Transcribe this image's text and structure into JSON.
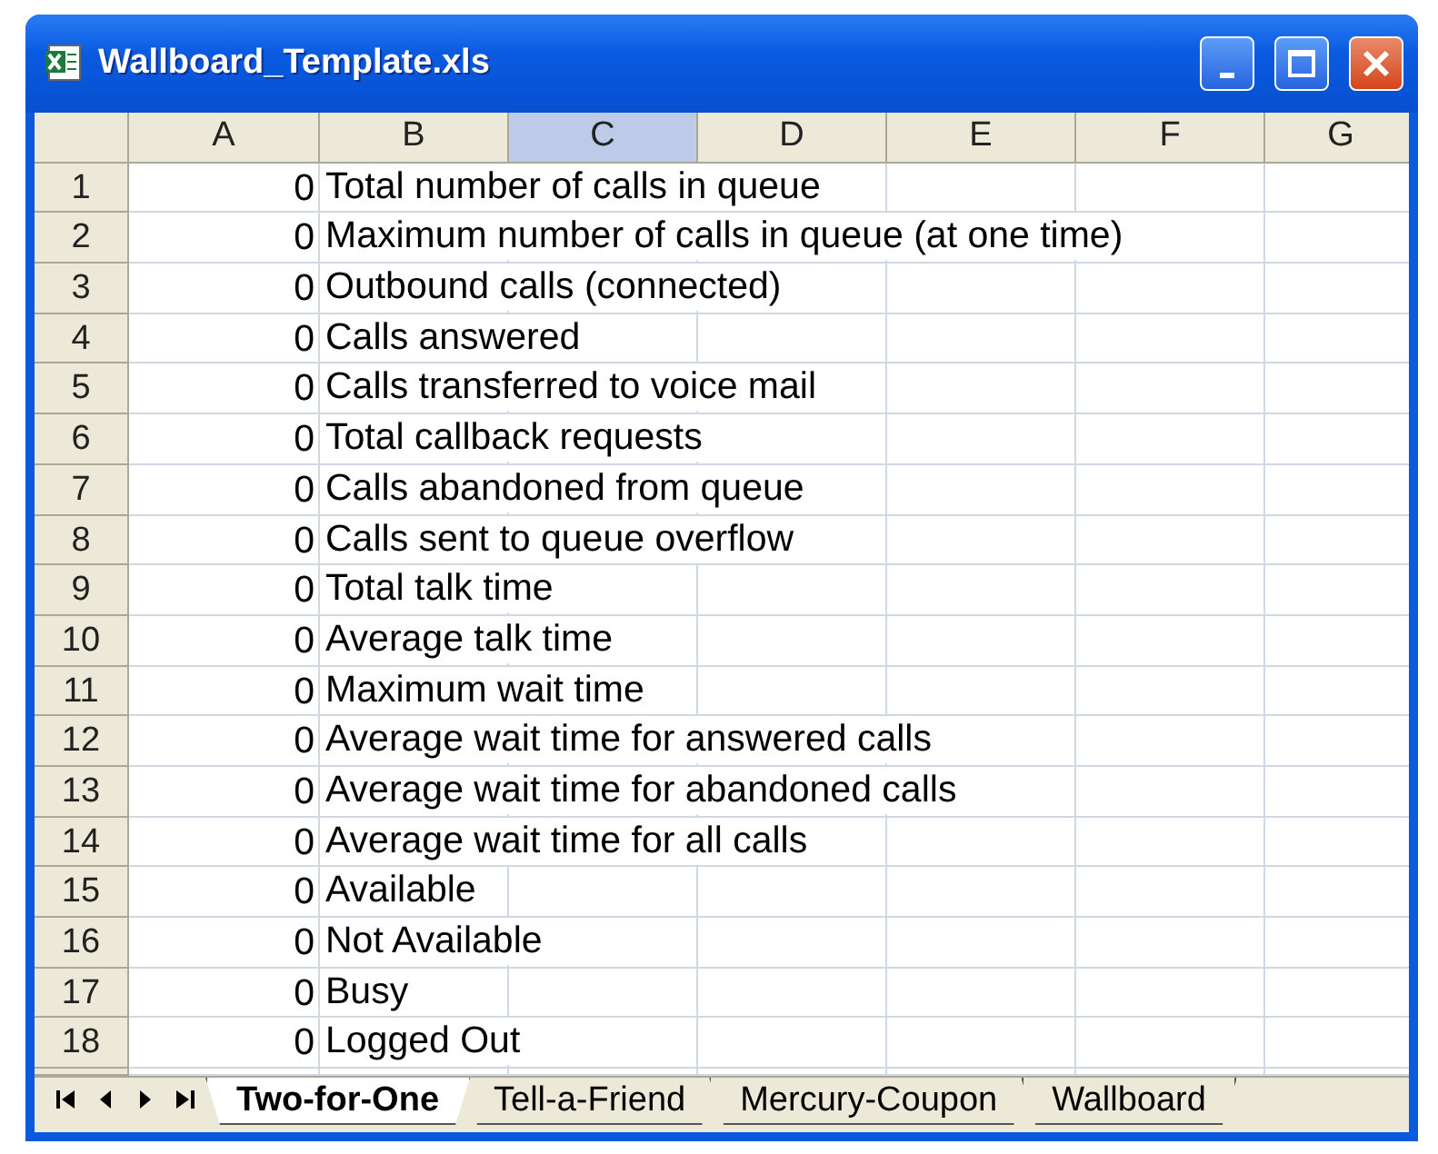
{
  "window": {
    "title": "Wallboard_Template.xls"
  },
  "columns": [
    {
      "label": "A",
      "selected": false
    },
    {
      "label": "B",
      "selected": false
    },
    {
      "label": "C",
      "selected": true
    },
    {
      "label": "D",
      "selected": false
    },
    {
      "label": "E",
      "selected": false
    },
    {
      "label": "F",
      "selected": false
    },
    {
      "label": "G",
      "selected": false
    }
  ],
  "rows": [
    {
      "number": "1",
      "a": "0",
      "b": "Total number of calls in queue"
    },
    {
      "number": "2",
      "a": "0",
      "b": "Maximum number of calls in queue (at one time)"
    },
    {
      "number": "3",
      "a": "0",
      "b": "Outbound calls (connected)"
    },
    {
      "number": "4",
      "a": "0",
      "b": "Calls answered"
    },
    {
      "number": "5",
      "a": "0",
      "b": "Calls transferred to voice mail"
    },
    {
      "number": "6",
      "a": "0",
      "b": "Total callback requests"
    },
    {
      "number": "7",
      "a": "0",
      "b": "Calls abandoned from queue"
    },
    {
      "number": "8",
      "a": "0",
      "b": "Calls sent to queue overflow"
    },
    {
      "number": "9",
      "a": "0",
      "b": "Total talk time"
    },
    {
      "number": "10",
      "a": "0",
      "b": "Average talk time"
    },
    {
      "number": "11",
      "a": "0",
      "b": "Maximum wait time"
    },
    {
      "number": "12",
      "a": "0",
      "b": "Average wait time for answered calls"
    },
    {
      "number": "13",
      "a": "0",
      "b": "Average wait time for abandoned calls"
    },
    {
      "number": "14",
      "a": "0",
      "b": "Average wait time for all calls"
    },
    {
      "number": "15",
      "a": "0",
      "b": "Available"
    },
    {
      "number": "16",
      "a": "0",
      "b": "Not Available"
    },
    {
      "number": "17",
      "a": "0",
      "b": "Busy"
    },
    {
      "number": "18",
      "a": "0",
      "b": "Logged Out"
    }
  ],
  "sheet_tabs": [
    {
      "label": "Two-for-One",
      "selected": true
    },
    {
      "label": "Tell-a-Friend",
      "selected": false
    },
    {
      "label": "Mercury-Coupon",
      "selected": false
    },
    {
      "label": "Wallboard",
      "selected": false
    }
  ]
}
